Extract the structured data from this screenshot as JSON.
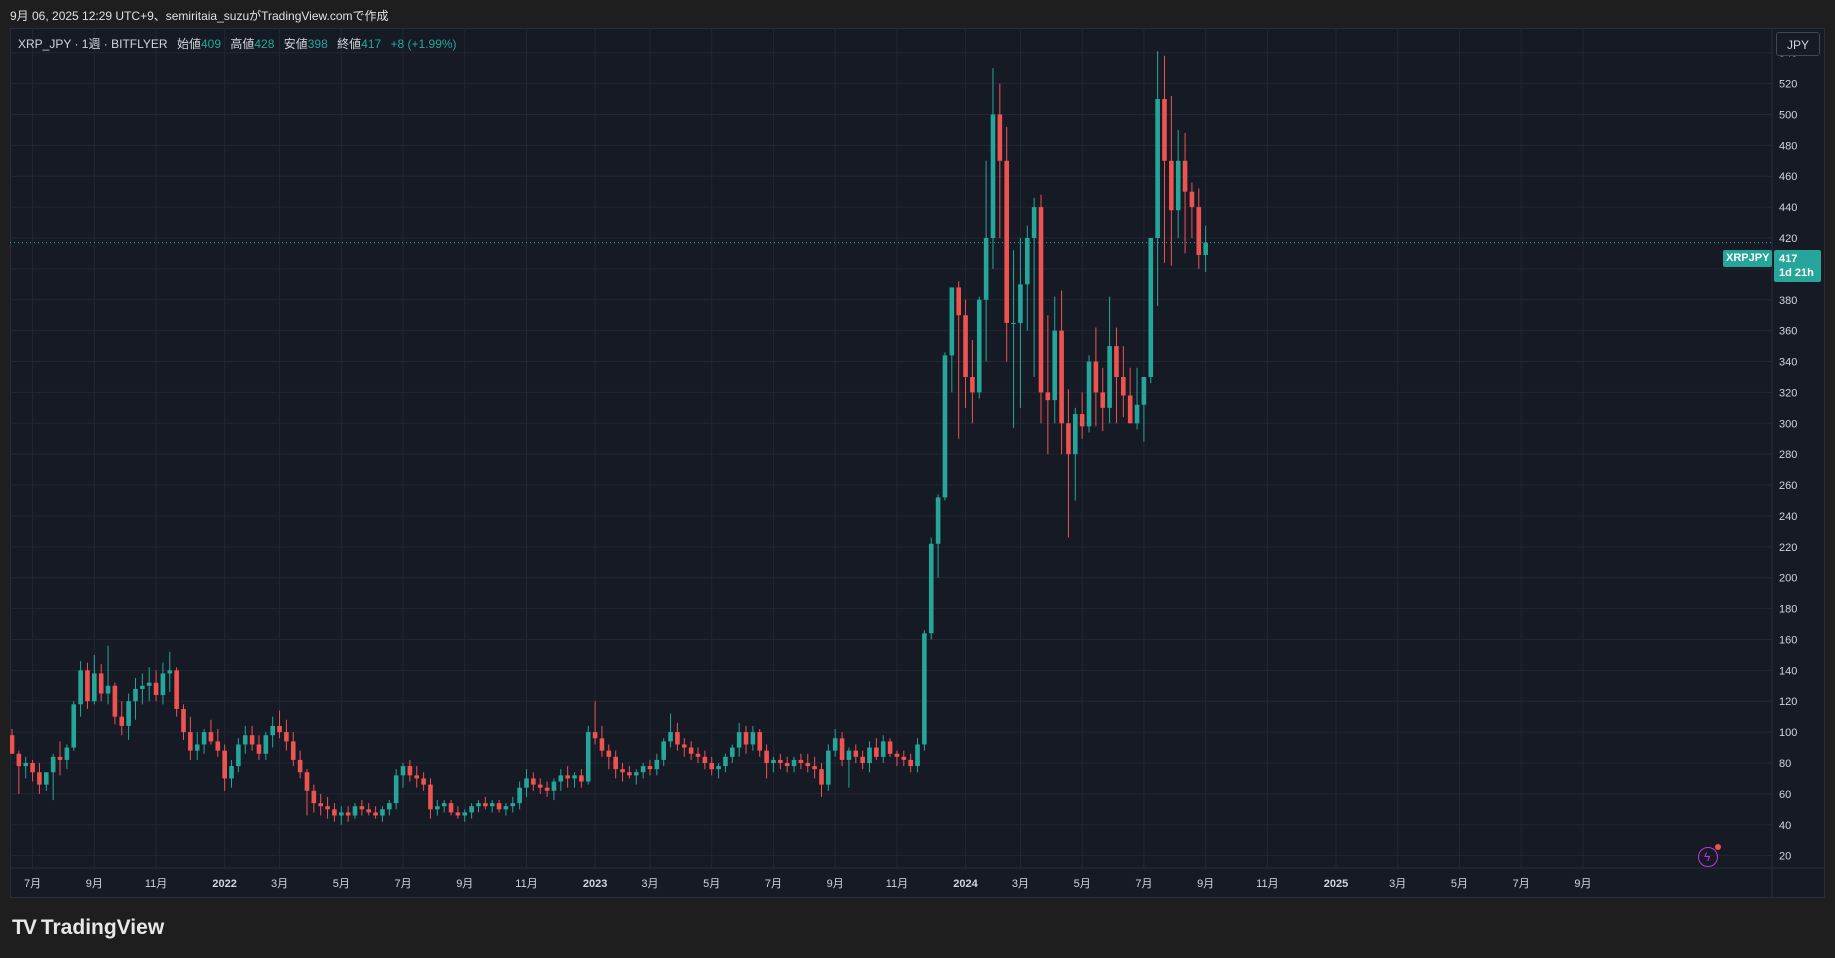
{
  "header": {
    "caption": "9月 06, 2025 12:29 UTC+9、semiritaia_suzuがTradingView.comで作成"
  },
  "legend": {
    "symbol": "XRP_JPY · 1週 · BITFLYER",
    "open_label": "始値",
    "open": "409",
    "high_label": "高値",
    "high": "428",
    "low_label": "安値",
    "low": "398",
    "close_label": "終値",
    "close": "417",
    "change": "+8 (+1.99%)"
  },
  "currency_button": "JPY",
  "last_price": {
    "symbol": "XRPJPY",
    "price": "417",
    "countdown": "1d 21h"
  },
  "brand": {
    "name": "TradingView"
  },
  "colors": {
    "up": "#26a69a",
    "down": "#ef5350",
    "background": "#161a25",
    "grid": "#232733",
    "text": "#d1d4dc"
  },
  "chart_data": {
    "type": "candlestick",
    "interval": "1週",
    "exchange": "BITFLYER",
    "currency": "JPY",
    "ylim": [
      12,
      556
    ],
    "y_ticks": [
      20,
      40,
      60,
      80,
      100,
      120,
      140,
      160,
      180,
      200,
      220,
      240,
      260,
      280,
      300,
      320,
      340,
      360,
      380,
      400,
      420,
      440,
      460,
      480,
      500,
      520,
      540
    ],
    "x_ticks": [
      "7月",
      "9月",
      "11月",
      "2022",
      "3月",
      "5月",
      "7月",
      "9月",
      "11月",
      "2023",
      "3月",
      "5月",
      "7月",
      "9月",
      "11月",
      "2024",
      "3月",
      "5月",
      "7月",
      "9月",
      "11月",
      "2025",
      "3月",
      "5月",
      "7月",
      "9月"
    ],
    "x_tick_index": [
      3,
      12,
      21,
      31,
      39,
      48,
      57,
      66,
      75,
      85,
      93,
      102,
      111,
      120,
      129,
      139,
      147,
      156,
      165,
      174,
      183,
      193,
      202,
      211,
      220,
      229
    ],
    "grid": true,
    "last_close": 417,
    "candles_ohlc": [
      [
        98,
        102,
        86,
        86
      ],
      [
        86,
        88,
        60,
        78
      ],
      [
        78,
        84,
        70,
        80
      ],
      [
        80,
        82,
        68,
        74
      ],
      [
        74,
        80,
        60,
        66
      ],
      [
        66,
        72,
        62,
        74
      ],
      [
        74,
        86,
        56,
        84
      ],
      [
        84,
        94,
        72,
        82
      ],
      [
        82,
        92,
        76,
        90
      ],
      [
        90,
        120,
        88,
        118
      ],
      [
        118,
        146,
        110,
        140
      ],
      [
        140,
        145,
        115,
        120
      ],
      [
        120,
        150,
        118,
        138
      ],
      [
        138,
        144,
        120,
        125
      ],
      [
        125,
        156,
        118,
        130
      ],
      [
        130,
        132,
        105,
        110
      ],
      [
        110,
        120,
        98,
        104
      ],
      [
        104,
        125,
        95,
        120
      ],
      [
        120,
        135,
        108,
        128
      ],
      [
        128,
        138,
        118,
        130
      ],
      [
        130,
        142,
        120,
        132
      ],
      [
        132,
        140,
        120,
        124
      ],
      [
        124,
        145,
        118,
        138
      ],
      [
        138,
        152,
        126,
        140
      ],
      [
        140,
        142,
        110,
        115
      ],
      [
        115,
        118,
        95,
        100
      ],
      [
        100,
        110,
        82,
        88
      ],
      [
        88,
        100,
        82,
        92
      ],
      [
        92,
        102,
        86,
        100
      ],
      [
        100,
        108,
        92,
        94
      ],
      [
        94,
        102,
        84,
        88
      ],
      [
        88,
        92,
        62,
        70
      ],
      [
        70,
        82,
        64,
        78
      ],
      [
        78,
        96,
        74,
        92
      ],
      [
        92,
        104,
        86,
        98
      ],
      [
        98,
        104,
        88,
        92
      ],
      [
        92,
        98,
        82,
        86
      ],
      [
        86,
        100,
        82,
        98
      ],
      [
        98,
        110,
        90,
        104
      ],
      [
        104,
        114,
        96,
        100
      ],
      [
        100,
        108,
        88,
        94
      ],
      [
        94,
        100,
        78,
        82
      ],
      [
        82,
        88,
        70,
        74
      ],
      [
        74,
        76,
        46,
        62
      ],
      [
        62,
        66,
        48,
        54
      ],
      [
        54,
        60,
        46,
        52
      ],
      [
        52,
        58,
        44,
        50
      ],
      [
        50,
        54,
        42,
        46
      ],
      [
        46,
        52,
        40,
        48
      ],
      [
        48,
        52,
        42,
        46
      ],
      [
        46,
        54,
        44,
        52
      ],
      [
        52,
        56,
        46,
        50
      ],
      [
        50,
        54,
        46,
        48
      ],
      [
        48,
        52,
        44,
        46
      ],
      [
        46,
        52,
        42,
        50
      ],
      [
        50,
        56,
        46,
        54
      ],
      [
        54,
        76,
        50,
        72
      ],
      [
        72,
        80,
        64,
        78
      ],
      [
        78,
        82,
        68,
        72
      ],
      [
        72,
        78,
        64,
        70
      ],
      [
        70,
        74,
        62,
        66
      ],
      [
        66,
        70,
        44,
        50
      ],
      [
        50,
        56,
        46,
        52
      ],
      [
        52,
        56,
        48,
        54
      ],
      [
        54,
        56,
        46,
        48
      ],
      [
        48,
        52,
        44,
        46
      ],
      [
        46,
        50,
        42,
        48
      ],
      [
        48,
        54,
        44,
        52
      ],
      [
        52,
        56,
        48,
        54
      ],
      [
        54,
        58,
        50,
        52
      ],
      [
        52,
        56,
        48,
        54
      ],
      [
        54,
        56,
        48,
        50
      ],
      [
        50,
        54,
        46,
        52
      ],
      [
        52,
        58,
        48,
        54
      ],
      [
        54,
        68,
        50,
        64
      ],
      [
        64,
        76,
        58,
        70
      ],
      [
        70,
        74,
        62,
        66
      ],
      [
        66,
        70,
        60,
        64
      ],
      [
        64,
        68,
        58,
        62
      ],
      [
        62,
        70,
        56,
        68
      ],
      [
        68,
        76,
        62,
        72
      ],
      [
        72,
        78,
        64,
        70
      ],
      [
        70,
        74,
        64,
        72
      ],
      [
        72,
        76,
        64,
        68
      ],
      [
        68,
        104,
        66,
        100
      ],
      [
        100,
        120,
        92,
        96
      ],
      [
        96,
        104,
        84,
        88
      ],
      [
        88,
        92,
        76,
        84
      ],
      [
        84,
        88,
        70,
        76
      ],
      [
        76,
        80,
        68,
        74
      ],
      [
        74,
        78,
        70,
        72
      ],
      [
        72,
        76,
        66,
        74
      ],
      [
        74,
        80,
        70,
        78
      ],
      [
        78,
        82,
        72,
        76
      ],
      [
        76,
        86,
        72,
        82
      ],
      [
        82,
        96,
        78,
        94
      ],
      [
        94,
        112,
        90,
        100
      ],
      [
        100,
        106,
        88,
        92
      ],
      [
        92,
        96,
        84,
        90
      ],
      [
        90,
        94,
        82,
        86
      ],
      [
        86,
        90,
        80,
        84
      ],
      [
        84,
        88,
        76,
        80
      ],
      [
        80,
        84,
        72,
        76
      ],
      [
        76,
        80,
        70,
        78
      ],
      [
        78,
        86,
        74,
        84
      ],
      [
        84,
        92,
        80,
        90
      ],
      [
        90,
        106,
        84,
        100
      ],
      [
        100,
        104,
        86,
        92
      ],
      [
        92,
        104,
        88,
        100
      ],
      [
        100,
        102,
        84,
        88
      ],
      [
        88,
        92,
        70,
        80
      ],
      [
        80,
        84,
        74,
        82
      ],
      [
        82,
        86,
        76,
        80
      ],
      [
        80,
        84,
        74,
        78
      ],
      [
        78,
        84,
        74,
        82
      ],
      [
        82,
        86,
        76,
        80
      ],
      [
        80,
        86,
        74,
        78
      ],
      [
        78,
        84,
        70,
        76
      ],
      [
        76,
        80,
        58,
        66
      ],
      [
        66,
        92,
        62,
        88
      ],
      [
        88,
        102,
        84,
        96
      ],
      [
        96,
        100,
        78,
        82
      ],
      [
        82,
        90,
        64,
        88
      ],
      [
        88,
        92,
        80,
        84
      ],
      [
        84,
        88,
        76,
        80
      ],
      [
        80,
        94,
        74,
        90
      ],
      [
        90,
        96,
        82,
        84
      ],
      [
        84,
        98,
        80,
        94
      ],
      [
        94,
        96,
        84,
        86
      ],
      [
        86,
        88,
        78,
        84
      ],
      [
        84,
        88,
        78,
        82
      ],
      [
        82,
        86,
        74,
        78
      ],
      [
        78,
        96,
        74,
        92
      ],
      [
        92,
        166,
        88,
        164
      ],
      [
        164,
        226,
        160,
        222
      ],
      [
        222,
        254,
        200,
        252
      ],
      [
        252,
        346,
        250,
        344
      ],
      [
        344,
        386,
        320,
        388
      ],
      [
        388,
        392,
        290,
        370
      ],
      [
        370,
        380,
        310,
        330
      ],
      [
        330,
        354,
        300,
        320
      ],
      [
        320,
        382,
        316,
        380
      ],
      [
        380,
        470,
        340,
        420
      ],
      [
        420,
        530,
        400,
        500
      ],
      [
        500,
        520,
        420,
        470
      ],
      [
        470,
        492,
        340,
        365
      ],
      [
        365,
        412,
        297,
        365
      ],
      [
        365,
        420,
        310,
        390
      ],
      [
        390,
        428,
        360,
        420
      ],
      [
        420,
        446,
        330,
        440
      ],
      [
        440,
        448,
        300,
        320
      ],
      [
        320,
        370,
        280,
        315
      ],
      [
        315,
        382,
        300,
        360
      ],
      [
        360,
        386,
        280,
        300
      ],
      [
        300,
        322,
        226,
        280
      ],
      [
        280,
        310,
        250,
        306
      ],
      [
        306,
        320,
        290,
        298
      ],
      [
        298,
        344,
        294,
        340
      ],
      [
        340,
        362,
        298,
        320
      ],
      [
        320,
        336,
        295,
        310
      ],
      [
        310,
        382,
        300,
        350
      ],
      [
        350,
        362,
        300,
        330
      ],
      [
        330,
        350,
        304,
        318
      ],
      [
        318,
        336,
        300,
        300
      ],
      [
        300,
        336,
        296,
        312
      ],
      [
        312,
        330,
        288,
        330
      ],
      [
        330,
        420,
        326,
        420
      ],
      [
        420,
        541,
        376,
        510
      ],
      [
        510,
        538,
        404,
        470
      ],
      [
        470,
        512,
        402,
        438
      ],
      [
        438,
        490,
        420,
        470
      ],
      [
        470,
        488,
        410,
        450
      ],
      [
        450,
        456,
        420,
        440
      ],
      [
        440,
        452,
        400,
        409
      ],
      [
        409,
        428,
        398,
        417
      ]
    ]
  }
}
